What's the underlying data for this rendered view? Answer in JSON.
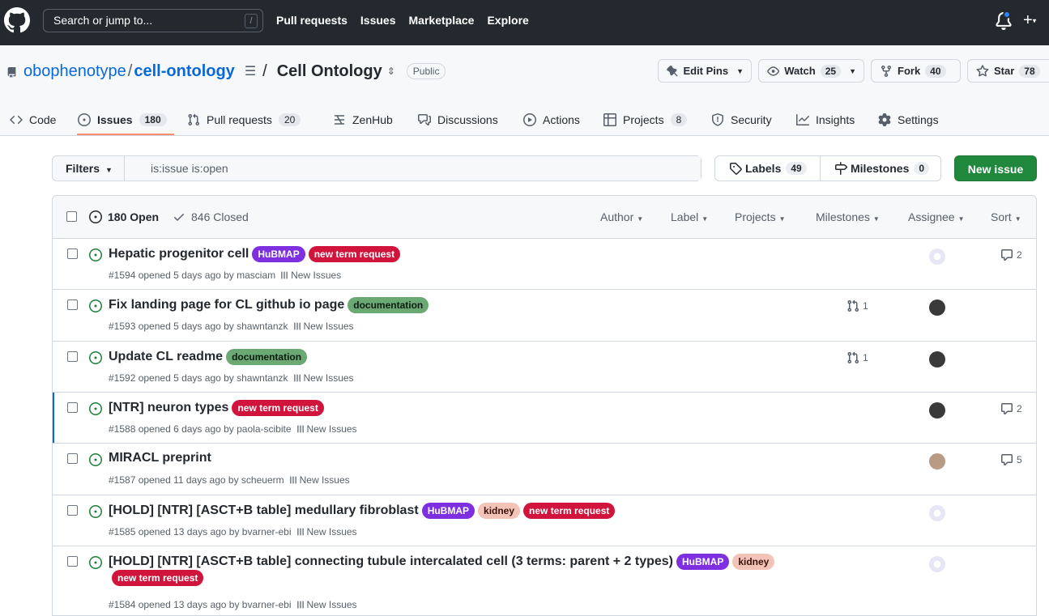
{
  "topbar": {
    "search_placeholder": "Search or jump to...",
    "slash_key": "/",
    "nav": [
      "Pull requests",
      "Issues",
      "Marketplace",
      "Explore"
    ],
    "plus": "+"
  },
  "repo": {
    "owner": "obophenotype",
    "name": "cell-ontology",
    "separator": "/",
    "project_name": "Cell Ontology",
    "visibility": "Public",
    "edit_pins": "Edit Pins",
    "watch": "Watch",
    "watch_count": "25",
    "fork": "Fork",
    "fork_count": "40",
    "star": "Star",
    "star_count": "78"
  },
  "tabs": [
    {
      "label": "Code",
      "icon": "code-icon"
    },
    {
      "label": "Issues",
      "count": "180",
      "icon": "issue-opened-icon"
    },
    {
      "label": "Pull requests",
      "count": "20",
      "icon": "pull-request-icon"
    },
    {
      "label": "ZenHub",
      "icon": "zenhub-icon"
    },
    {
      "label": "Discussions",
      "icon": "discussions-icon"
    },
    {
      "label": "Actions",
      "icon": "play-icon"
    },
    {
      "label": "Projects",
      "count": "8",
      "icon": "table-icon"
    },
    {
      "label": "Security",
      "icon": "shield-icon"
    },
    {
      "label": "Insights",
      "icon": "graph-icon"
    },
    {
      "label": "Settings",
      "icon": "gear-icon"
    }
  ],
  "filters": {
    "button": "Filters",
    "query": "is:issue is:open",
    "labels": "Labels",
    "labels_count": "49",
    "milestones": "Milestones",
    "milestones_count": "0",
    "new_issue": "New issue"
  },
  "list_header": {
    "open": "180 Open",
    "closed": "846 Closed",
    "filters": [
      "Author",
      "Label",
      "Projects",
      "Milestones",
      "Assignee",
      "Sort"
    ]
  },
  "issues": [
    {
      "title": "Hepatic progenitor cell",
      "labels": [
        {
          "text": "HuBMAP",
          "bg": "#7e2fe0",
          "fg": "#ffffff"
        },
        {
          "text": "new term request",
          "bg": "#d0143c",
          "fg": "#ffffff"
        }
      ],
      "meta": "#1594 opened 5 days ago by masciam",
      "board": "New Issues",
      "comments": "2",
      "linked_prs": ""
    },
    {
      "title": "Fix landing page for CL github io page",
      "labels": [
        {
          "text": "documentation",
          "bg": "#6aa874",
          "fg": "#0d1b10"
        }
      ],
      "meta": "#1593 opened 5 days ago by shawntanzk",
      "board": "New Issues",
      "comments": "",
      "linked_prs": "1"
    },
    {
      "title": "Update CL readme",
      "labels": [
        {
          "text": "documentation",
          "bg": "#6aa874",
          "fg": "#0d1b10"
        }
      ],
      "meta": "#1592 opened 5 days ago by shawntanzk",
      "board": "New Issues",
      "comments": "",
      "linked_prs": "1"
    },
    {
      "title": "[NTR] neuron types",
      "labels": [
        {
          "text": "new term request",
          "bg": "#d0143c",
          "fg": "#ffffff"
        }
      ],
      "meta": "#1588 opened 6 days ago by paola-scibite",
      "board": "New Issues",
      "comments": "2",
      "linked_prs": ""
    },
    {
      "title": "MIRACL preprint",
      "labels": [],
      "meta": "#1587 opened 11 days ago by scheuerm",
      "board": "New Issues",
      "comments": "5",
      "linked_prs": ""
    },
    {
      "title": "[HOLD] [NTR] [ASCT+B table] medullary fibroblast",
      "labels": [
        {
          "text": "HuBMAP",
          "bg": "#7e2fe0",
          "fg": "#ffffff"
        },
        {
          "text": "kidney",
          "bg": "#f3c3b8",
          "fg": "#3b1208"
        },
        {
          "text": "new term request",
          "bg": "#d0143c",
          "fg": "#ffffff"
        }
      ],
      "meta": "#1585 opened 13 days ago by bvarner-ebi",
      "board": "New Issues",
      "comments": "",
      "linked_prs": ""
    },
    {
      "title": "[HOLD] [NTR] [ASCT+B table] connecting tubule intercalated cell (3 terms: parent + 2 types)",
      "labels": [
        {
          "text": "HuBMAP",
          "bg": "#7e2fe0",
          "fg": "#ffffff"
        },
        {
          "text": "kidney",
          "bg": "#f3c3b8",
          "fg": "#3b1208"
        },
        {
          "text": "new term request",
          "bg": "#d0143c",
          "fg": "#ffffff"
        }
      ],
      "meta": "#1584 opened 13 days ago by bvarner-ebi",
      "board": "New Issues",
      "comments": "",
      "linked_prs": ""
    }
  ]
}
